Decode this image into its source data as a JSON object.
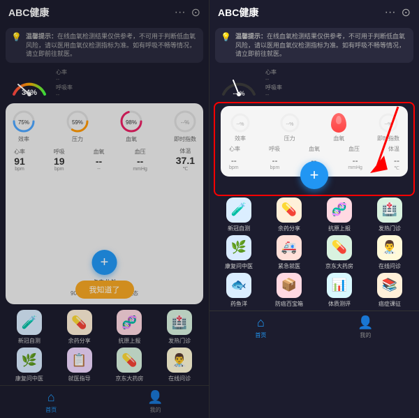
{
  "app": {
    "title": "ABC健康",
    "warning_title": "温馨提示：",
    "warning_text": "在线血氧检测结果仅供参考，不可用于判断低血氧风险，请以医用血氧仪检测指标为准。如有呼吸不畅等情况，请立即前往就医。",
    "gauge_value": "34%",
    "gauge_dashes": "---%",
    "heart_rate_label": "心率",
    "sleep_label": "呼吸率",
    "efficiency_label": "效率",
    "pressure_label": "压力",
    "blood_oxygen_label": "血氧",
    "finger_label": "即时指数",
    "hr_label": "心率",
    "breath_label": "呼吸",
    "blood_label": "血氧",
    "bp_label": "血压",
    "temp_label": "体温",
    "efficiency_val": "75%",
    "pressure_val": "59%",
    "blood_oxygen_val": "98%",
    "finger_val": "--%",
    "hr_val": "91",
    "breath_val": "19",
    "blood_val": "--",
    "bp_val": "--",
    "temp_val": "37.1",
    "hr_unit": "bpm",
    "breath_unit": "bpm",
    "blood_unit": "--",
    "bp_unit": "mmHg",
    "temp_unit": "℃",
    "add_hint": "点击此处",
    "add_hint2": "90秒快速检测您的身体状态",
    "know_btn": "我知道了",
    "services": [
      {
        "name": "新冠自测",
        "color": "#e8f4fd",
        "icon_color": "#4da6ff"
      },
      {
        "name": "余药分享",
        "color": "#fff3e0",
        "icon_color": "#ff9800"
      },
      {
        "name": "抗原上报",
        "color": "#fce4ec",
        "icon_color": "#e91e63"
      },
      {
        "name": "发热门诊",
        "color": "#e8f5e9",
        "icon_color": "#4caf50"
      },
      {
        "name": "康复问中医",
        "color": "#e3f2fd",
        "icon_color": "#2196f3"
      },
      {
        "name": "就医指导",
        "color": "#f3e5f5",
        "icon_color": "#9c27b0"
      },
      {
        "name": "京东大药房",
        "color": "#e8f5e9",
        "icon_color": "#4caf50"
      },
      {
        "name": "在线问诊",
        "color": "#fff8e1",
        "icon_color": "#ffc107"
      },
      {
        "name": "药鱼洋",
        "color": "#e8f4fd",
        "icon_color": "#4da6ff"
      },
      {
        "name": "防癌百宝箱",
        "color": "#fce4ec",
        "icon_color": "#e91e63"
      },
      {
        "name": "体质测评",
        "color": "#e0f7fa",
        "icon_color": "#00bcd4"
      },
      {
        "name": "癌症课征",
        "color": "#fff3e0",
        "icon_color": "#ff9800"
      }
    ],
    "nav": [
      {
        "label": "首页",
        "active": true
      },
      {
        "label": "我的",
        "active": false
      }
    ],
    "right_panel": {
      "stats_row1": [
        {
          "label": "效率",
          "val": "--%"
        },
        {
          "label": "压力",
          "val": "--%"
        },
        {
          "label": "血氧",
          "val": "--%"
        },
        {
          "label": "即时指数",
          "val": "--%"
        }
      ],
      "stats_row2": [
        {
          "label": "心率",
          "val": "--",
          "unit": "bpm"
        },
        {
          "label": "呼吸",
          "val": "--",
          "unit": "bpm"
        },
        {
          "label": "血氧",
          "val": "--",
          "unit": "--"
        },
        {
          "label": "血压",
          "val": "--",
          "unit": "mmHg"
        },
        {
          "label": "体温",
          "val": "--",
          "unit": "℃"
        }
      ]
    }
  }
}
